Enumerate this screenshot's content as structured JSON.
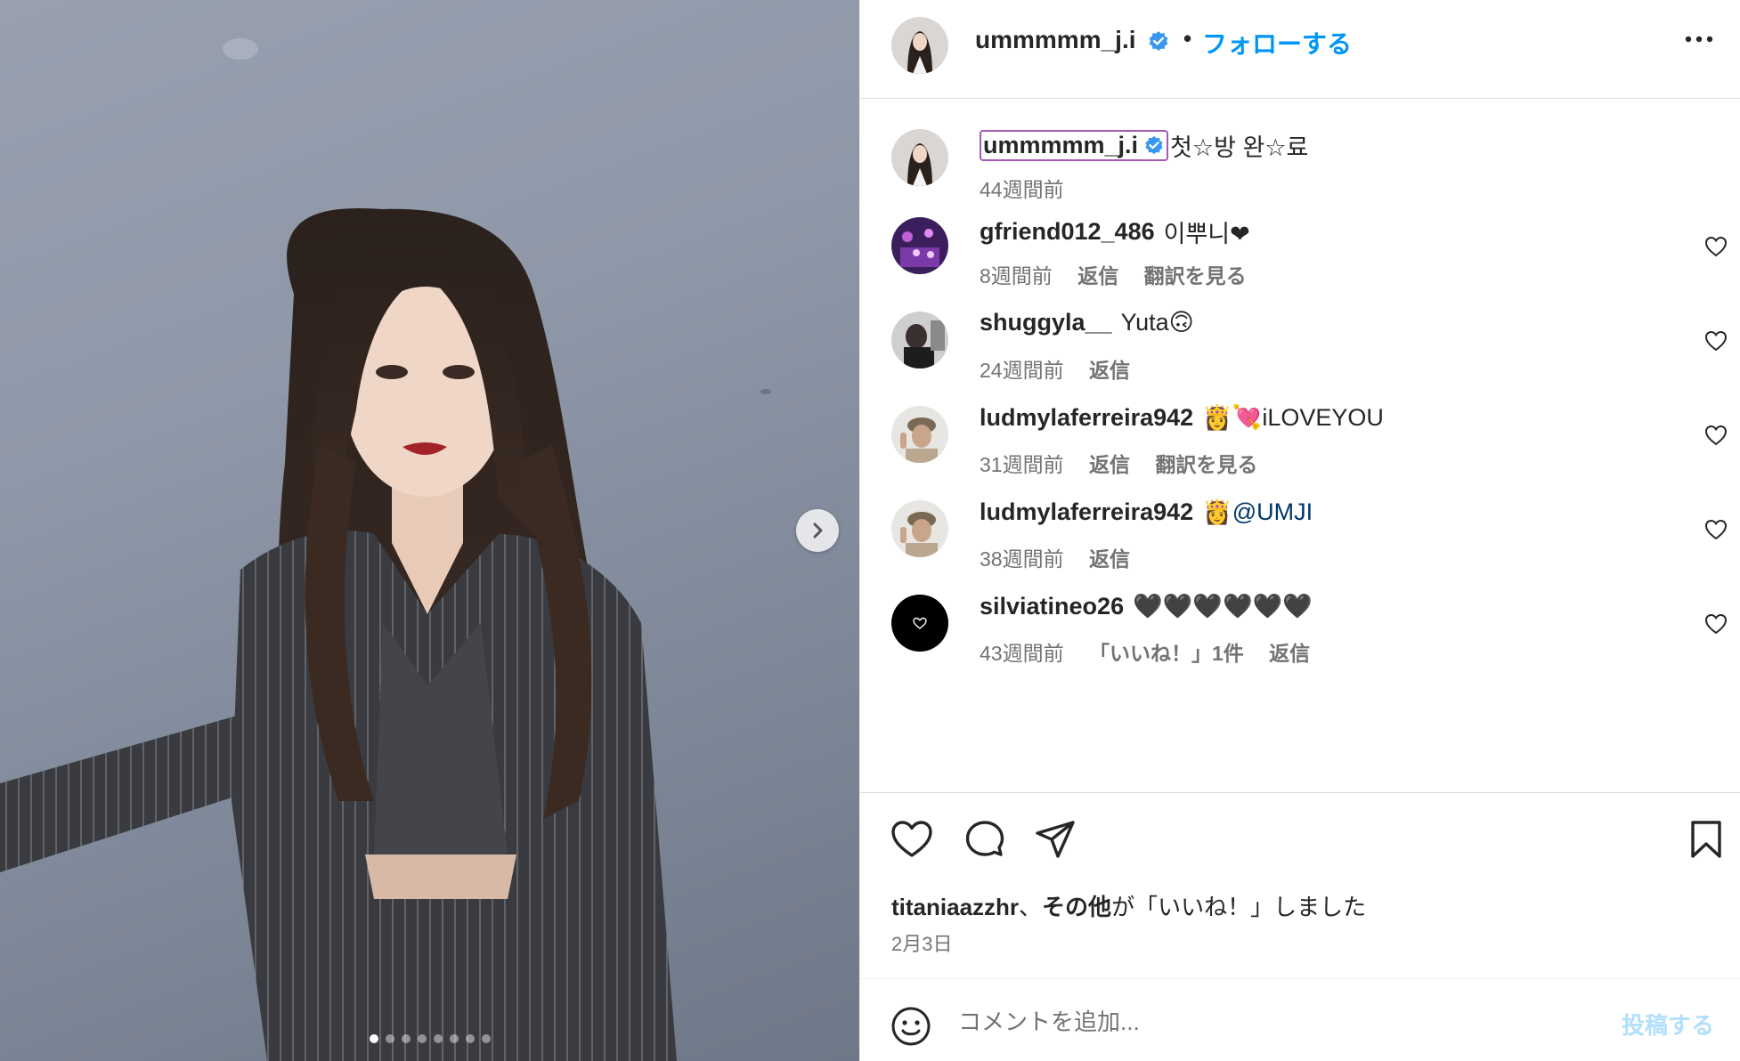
{
  "post": {
    "photo_alt": "",
    "carousel": {
      "count": 8,
      "active_index": 0
    }
  },
  "header": {
    "username": "ummmmm_j.i",
    "separator": "•",
    "follow_label": "フォローする"
  },
  "caption": {
    "username": "ummmmm_j.i",
    "text": "첫☆방 완☆료",
    "time": "44週間前"
  },
  "comments": [
    {
      "username": "gfriend012_486",
      "text": "이뿌니❤",
      "time": "8週間前",
      "actions": [
        "返信",
        "翻訳を見る"
      ]
    },
    {
      "username": "shuggyla__",
      "text": "Yuta🙃",
      "time": "24週間前",
      "actions": [
        "返信"
      ]
    },
    {
      "username": "ludmylaferreira942",
      "text": "👸💘iLOVEYOU",
      "time": "31週間前",
      "actions": [
        "返信",
        "翻訳を見る"
      ]
    },
    {
      "username": "ludmylaferreira942",
      "emoji": "👸",
      "mention": "@UMJI",
      "time": "38週間前",
      "actions": [
        "返信"
      ]
    },
    {
      "username": "silviatineo26",
      "text": "🖤🖤🖤🖤🖤🖤",
      "time": "43週間前",
      "actions": [
        "「いいね！」1件",
        "返信"
      ]
    }
  ],
  "likes": {
    "liker": "titaniaazzhr",
    "sep": "、",
    "others": "その他",
    "suffix": "が「いいね！」しました"
  },
  "date": "2月3日",
  "comment_box": {
    "placeholder": "コメントを追加...",
    "post_label": "投稿する"
  },
  "colors": {
    "accent": "#0095f6",
    "verified": "#3897f0",
    "highlight_border": "#a35bb5",
    "post_disabled": "#b2dffc"
  }
}
